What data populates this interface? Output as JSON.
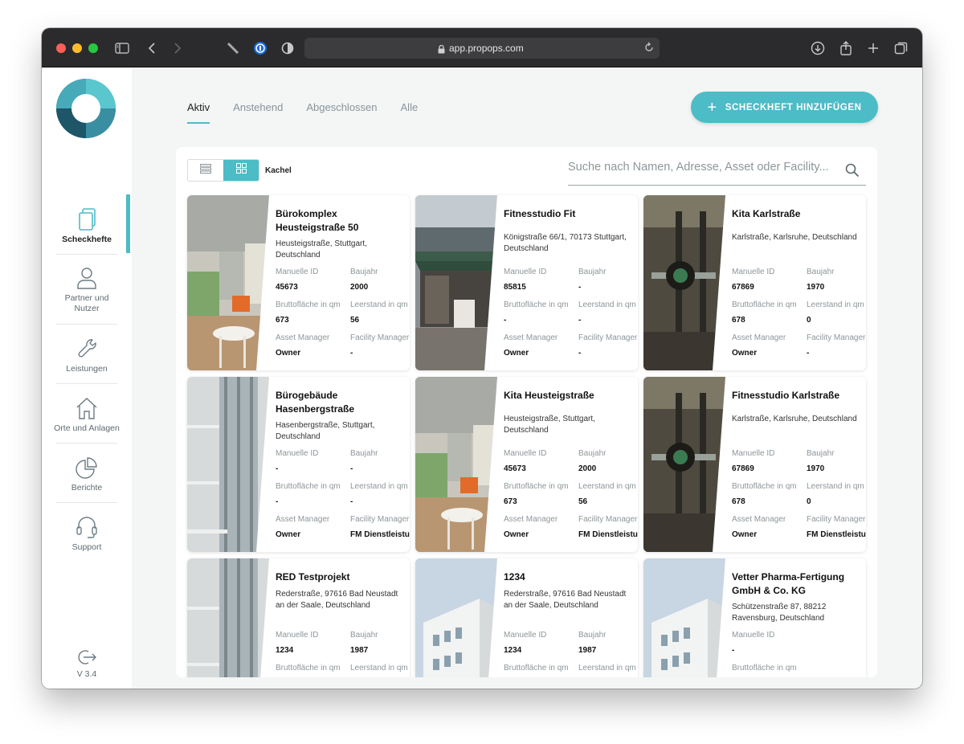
{
  "browser": {
    "url": "app.propops.com"
  },
  "sidebar": {
    "items": [
      {
        "label": "Scheckhefte",
        "icon": "document-copy-icon",
        "active": true
      },
      {
        "label": "Partner und Nutzer",
        "icon": "user-icon",
        "active": false
      },
      {
        "label": "Leistungen",
        "icon": "wrench-icon",
        "active": false
      },
      {
        "label": "Orte und Anlagen",
        "icon": "house-icon",
        "active": false
      },
      {
        "label": "Berichte",
        "icon": "pie-chart-icon",
        "active": false
      },
      {
        "label": "Support",
        "icon": "headset-icon",
        "active": false
      }
    ],
    "version": "V 3.4"
  },
  "tabs": [
    "Aktiv",
    "Anstehend",
    "Abgeschlossen",
    "Alle"
  ],
  "add_button": {
    "label": "SCHECKHEFT HINZUFÜGEN"
  },
  "view": {
    "mode_label": "Kachel"
  },
  "search": {
    "placeholder": "Suche nach Namen, Adresse, Asset oder Facility..."
  },
  "fields": {
    "manual_id": "Manuelle ID",
    "year": "Baujahr",
    "gross_area": "Bruttofläche in qm",
    "vacancy": "Leerstand in qm",
    "asset_manager": "Asset Manager",
    "facility_manager": "Facility Manager"
  },
  "cards": [
    {
      "title": "Bürokomplex Heusteigstraße 50",
      "address": "Heusteigstraße,  Stuttgart, Deutschland",
      "manual_id": "45673",
      "year": "2000",
      "gross_area": "673",
      "vacancy": "56",
      "asset_manager": "Owner",
      "facility_manager": "-",
      "image": "office"
    },
    {
      "title": "Fitnesstudio Fit",
      "address": "Königstraße 66/1, 70173 Stuttgart, Deutschland",
      "manual_id": "85815",
      "year": "-",
      "gross_area": "-",
      "vacancy": "-",
      "asset_manager": "Owner",
      "facility_manager": "-",
      "image": "shop"
    },
    {
      "title": "Kita Karlstraße",
      "address": "Karlstraße,  Karlsruhe, Deutschland",
      "manual_id": "67869",
      "year": "1970",
      "gross_area": "678",
      "vacancy": "0",
      "asset_manager": "Owner",
      "facility_manager": "-",
      "image": "gym"
    },
    {
      "title": "Bürogebäude Hasenbergstraße",
      "address": "Hasenbergstraße,  Stuttgart, Deutschland",
      "manual_id": "-",
      "year": "-",
      "gross_area": "-",
      "vacancy": "-",
      "asset_manager": "Owner",
      "facility_manager": "FM Dienstleistung",
      "image": "glass"
    },
    {
      "title": "Kita Heusteigstraße",
      "address": "Heusteigstraße,  Stuttgart, Deutschland",
      "manual_id": "45673",
      "year": "2000",
      "gross_area": "673",
      "vacancy": "56",
      "asset_manager": "Owner",
      "facility_manager": "FM Dienstleistung",
      "image": "office"
    },
    {
      "title": "Fitnesstudio Karlstraße",
      "address": "Karlstraße,  Karlsruhe, Deutschland",
      "manual_id": "67869",
      "year": "1970",
      "gross_area": "678",
      "vacancy": "0",
      "asset_manager": "Owner",
      "facility_manager": "FM Dienstleistung",
      "image": "gym"
    },
    {
      "title": "RED Testprojekt",
      "address": "Rederstraße, 97616 Bad Neustadt an der Saale, Deutschland",
      "manual_id": "1234",
      "year": "1987",
      "gross_area": "",
      "vacancy": "",
      "asset_manager": "",
      "facility_manager": "",
      "image": "glass"
    },
    {
      "title": "1234",
      "address": "Rederstraße, 97616 Bad Neustadt an der Saale, Deutschland",
      "manual_id": "1234",
      "year": "1987",
      "gross_area": "",
      "vacancy": "",
      "asset_manager": "",
      "facility_manager": "",
      "image": "building"
    },
    {
      "title": "Vetter Pharma-Fertigung GmbH & Co. KG",
      "address": "Schützenstraße 87, 88212 Ravensburg, Deutschland",
      "manual_id": "-",
      "year": null,
      "gross_area": "",
      "vacancy": null,
      "asset_manager": "",
      "facility_manager": "",
      "image": "building"
    }
  ],
  "colors": {
    "accent": "#4cbcc7",
    "titlebar": "#2b2b2d"
  }
}
